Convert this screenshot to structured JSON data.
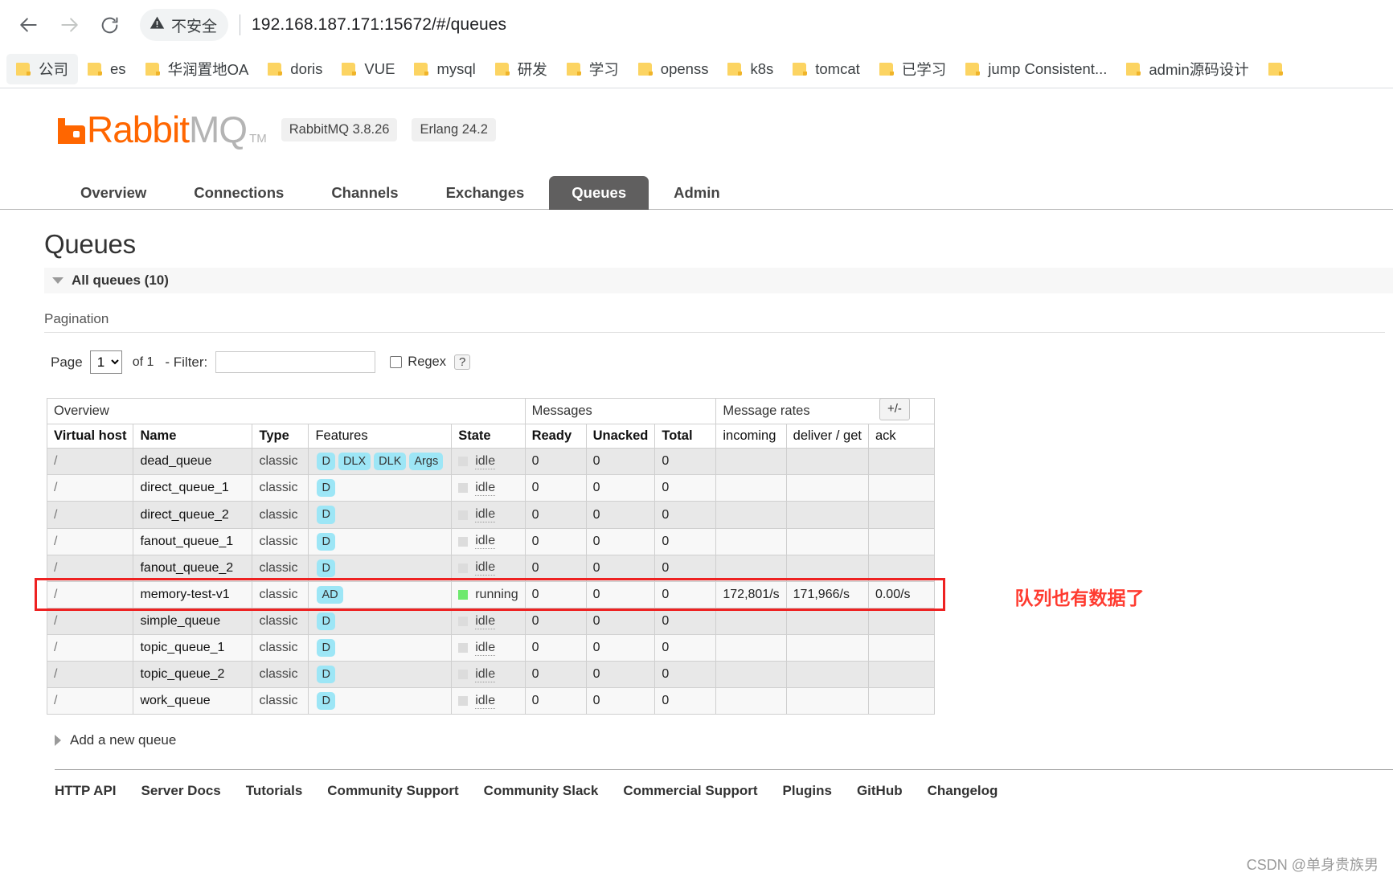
{
  "browser": {
    "back_icon": "back-arrow-icon",
    "forward_icon": "forward-arrow-icon",
    "reload_icon": "reload-icon",
    "security_warning_icon": "warning-triangle-icon",
    "security_warning_text": "不安全",
    "url": "192.168.187.171:15672/#/queues",
    "bookmarks": [
      {
        "label": "公司",
        "active": true
      },
      {
        "label": "es",
        "active": false
      },
      {
        "label": "华润置地OA",
        "active": false
      },
      {
        "label": "doris",
        "active": false
      },
      {
        "label": "VUE",
        "active": false
      },
      {
        "label": "mysql",
        "active": false
      },
      {
        "label": "研发",
        "active": false
      },
      {
        "label": "学习",
        "active": false
      },
      {
        "label": "openss",
        "active": false
      },
      {
        "label": "k8s",
        "active": false
      },
      {
        "label": "tomcat",
        "active": false
      },
      {
        "label": "已学习",
        "active": false
      },
      {
        "label": "jump Consistent...",
        "active": false
      },
      {
        "label": "admin源码设计",
        "active": false
      }
    ]
  },
  "app": {
    "logo_rabbit": "Rabbit",
    "logo_mq": "MQ",
    "logo_tm": "TM",
    "version_badge": "RabbitMQ 3.8.26",
    "erlang_badge": "Erlang 24.2",
    "brand_color": "#ff6600"
  },
  "tabs": [
    {
      "label": "Overview",
      "active": false
    },
    {
      "label": "Connections",
      "active": false
    },
    {
      "label": "Channels",
      "active": false
    },
    {
      "label": "Exchanges",
      "active": false
    },
    {
      "label": "Queues",
      "active": true
    },
    {
      "label": "Admin",
      "active": false
    }
  ],
  "page": {
    "title": "Queues",
    "all_queues_label": "All queues (10)",
    "pagination_label": "Pagination",
    "add_queue_label": "Add a new queue"
  },
  "filter": {
    "page_label": "Page",
    "page_value": "1",
    "page_options": [
      "1"
    ],
    "of_label": "of 1",
    "filter_label": "- Filter:",
    "filter_value": "",
    "filter_placeholder": "",
    "regex_label": "Regex",
    "regex_help": "?",
    "regex_checked": false
  },
  "table": {
    "plus_minus_label": "+/-",
    "group_headers": [
      {
        "label": "Overview",
        "span": 5
      },
      {
        "label": "Messages",
        "span": 3
      },
      {
        "label": "Message rates",
        "span": 3
      }
    ],
    "columns": [
      {
        "label": "Virtual host",
        "bold": true
      },
      {
        "label": "Name",
        "bold": true
      },
      {
        "label": "Type",
        "bold": true
      },
      {
        "label": "Features",
        "bold": false
      },
      {
        "label": "State",
        "bold": true
      },
      {
        "label": "Ready",
        "bold": true
      },
      {
        "label": "Unacked",
        "bold": true
      },
      {
        "label": "Total",
        "bold": true
      },
      {
        "label": "incoming",
        "bold": false
      },
      {
        "label": "deliver / get",
        "bold": false
      },
      {
        "label": "ack",
        "bold": false
      }
    ],
    "rows": [
      {
        "vhost": "/",
        "name": "dead_queue",
        "type": "classic",
        "features": [
          "D",
          "DLX",
          "DLK",
          "Args"
        ],
        "state": "idle",
        "running": false,
        "ready": "0",
        "unacked": "0",
        "total": "0",
        "incoming": "",
        "deliver": "",
        "ack": ""
      },
      {
        "vhost": "/",
        "name": "direct_queue_1",
        "type": "classic",
        "features": [
          "D"
        ],
        "state": "idle",
        "running": false,
        "ready": "0",
        "unacked": "0",
        "total": "0",
        "incoming": "",
        "deliver": "",
        "ack": ""
      },
      {
        "vhost": "/",
        "name": "direct_queue_2",
        "type": "classic",
        "features": [
          "D"
        ],
        "state": "idle",
        "running": false,
        "ready": "0",
        "unacked": "0",
        "total": "0",
        "incoming": "",
        "deliver": "",
        "ack": ""
      },
      {
        "vhost": "/",
        "name": "fanout_queue_1",
        "type": "classic",
        "features": [
          "D"
        ],
        "state": "idle",
        "running": false,
        "ready": "0",
        "unacked": "0",
        "total": "0",
        "incoming": "",
        "deliver": "",
        "ack": ""
      },
      {
        "vhost": "/",
        "name": "fanout_queue_2",
        "type": "classic",
        "features": [
          "D"
        ],
        "state": "idle",
        "running": false,
        "ready": "0",
        "unacked": "0",
        "total": "0",
        "incoming": "",
        "deliver": "",
        "ack": ""
      },
      {
        "vhost": "/",
        "name": "memory-test-v1",
        "type": "classic",
        "features": [
          "AD"
        ],
        "state": "running",
        "running": true,
        "ready": "0",
        "unacked": "0",
        "total": "0",
        "incoming": "172,801/s",
        "deliver": "171,966/s",
        "ack": "0.00/s",
        "highlighted": true
      },
      {
        "vhost": "/",
        "name": "simple_queue",
        "type": "classic",
        "features": [
          "D"
        ],
        "state": "idle",
        "running": false,
        "ready": "0",
        "unacked": "0",
        "total": "0",
        "incoming": "",
        "deliver": "",
        "ack": ""
      },
      {
        "vhost": "/",
        "name": "topic_queue_1",
        "type": "classic",
        "features": [
          "D"
        ],
        "state": "idle",
        "running": false,
        "ready": "0",
        "unacked": "0",
        "total": "0",
        "incoming": "",
        "deliver": "",
        "ack": ""
      },
      {
        "vhost": "/",
        "name": "topic_queue_2",
        "type": "classic",
        "features": [
          "D"
        ],
        "state": "idle",
        "running": false,
        "ready": "0",
        "unacked": "0",
        "total": "0",
        "incoming": "",
        "deliver": "",
        "ack": ""
      },
      {
        "vhost": "/",
        "name": "work_queue",
        "type": "classic",
        "features": [
          "D"
        ],
        "state": "idle",
        "running": false,
        "ready": "0",
        "unacked": "0",
        "total": "0",
        "incoming": "",
        "deliver": "",
        "ack": ""
      }
    ]
  },
  "annotation": {
    "text": "队列也有数据了",
    "color": "#ff3b30"
  },
  "footer": {
    "links": [
      "HTTP API",
      "Server Docs",
      "Tutorials",
      "Community Support",
      "Community Slack",
      "Commercial Support",
      "Plugins",
      "GitHub",
      "Changelog"
    ]
  },
  "watermark": "CSDN @单身贵族男"
}
